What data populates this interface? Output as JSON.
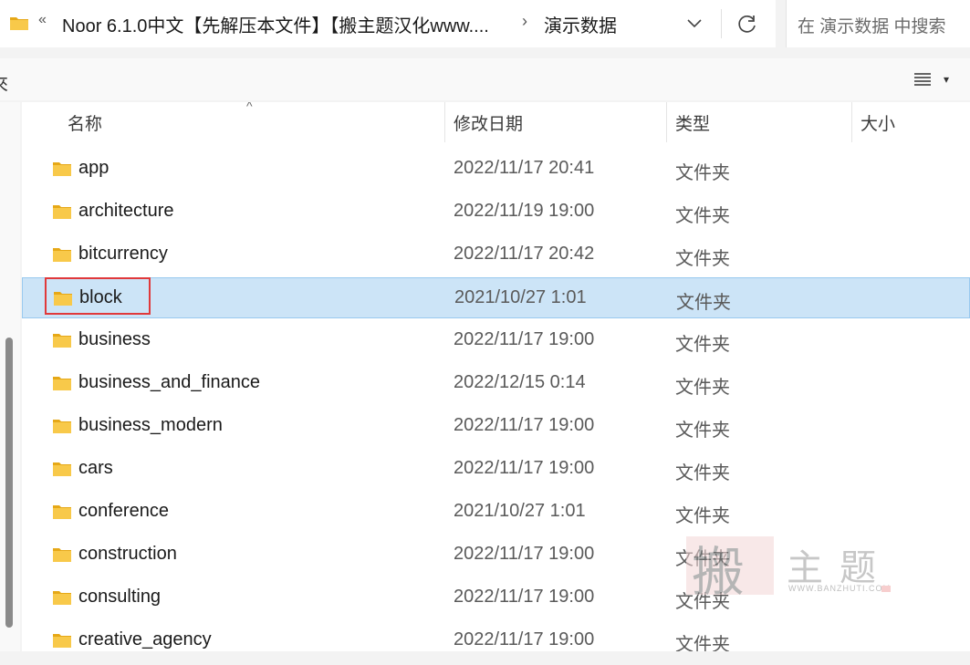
{
  "address_bar": {
    "back_chevrons": "«",
    "crumb_parent": "Noor 6.1.0中文【先解压本文件】【搬主题汉化www....",
    "separator": "›",
    "crumb_current": "演示数据"
  },
  "search": {
    "placeholder": "在 演示数据 中搜索"
  },
  "toolbar": {
    "left_fragment": "來"
  },
  "columns": {
    "name": "名称",
    "date": "修改日期",
    "type": "类型",
    "size": "大小"
  },
  "files": [
    {
      "name": "app",
      "date": "2022/11/17 20:41",
      "type": "文件夹"
    },
    {
      "name": "architecture",
      "date": "2022/11/19 19:00",
      "type": "文件夹"
    },
    {
      "name": "bitcurrency",
      "date": "2022/11/17 20:42",
      "type": "文件夹"
    },
    {
      "name": "block",
      "date": "2021/10/27 1:01",
      "type": "文件夹",
      "selected": true
    },
    {
      "name": "business",
      "date": "2022/11/17 19:00",
      "type": "文件夹"
    },
    {
      "name": "business_and_finance",
      "date": "2022/12/15 0:14",
      "type": "文件夹"
    },
    {
      "name": "business_modern",
      "date": "2022/11/17 19:00",
      "type": "文件夹"
    },
    {
      "name": "cars",
      "date": "2022/11/17 19:00",
      "type": "文件夹"
    },
    {
      "name": "conference",
      "date": "2021/10/27 1:01",
      "type": "文件夹"
    },
    {
      "name": "construction",
      "date": "2022/11/17 19:00",
      "type": "文件夹"
    },
    {
      "name": "consulting",
      "date": "2022/11/17 19:00",
      "type": "文件夹"
    },
    {
      "name": "creative_agency",
      "date": "2022/11/17 19:00",
      "type": "文件夹"
    }
  ],
  "watermark": {
    "seal_char": "搬",
    "text": "主题",
    "url": "WWW.BANZHUTI.COM"
  },
  "colors": {
    "selection": "#cce4f7",
    "highlight": "#e0393b",
    "folder": "#f8c94a"
  }
}
